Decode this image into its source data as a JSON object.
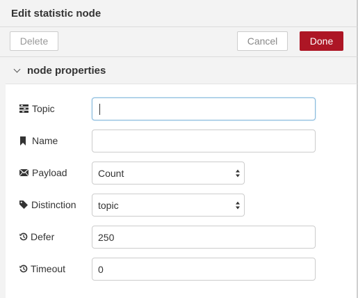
{
  "header": {
    "title": "Edit statistic node"
  },
  "toolbar": {
    "delete_label": "Delete",
    "cancel_label": "Cancel",
    "done_label": "Done"
  },
  "section": {
    "title": "node properties"
  },
  "fields": {
    "topic": {
      "label": "Topic",
      "value": ""
    },
    "name": {
      "label": "Name",
      "value": ""
    },
    "payload": {
      "label": "Payload",
      "selected": "Count"
    },
    "distinction": {
      "label": "Distinction",
      "selected": "topic"
    },
    "defer": {
      "label": "Defer",
      "value": "250"
    },
    "timeout": {
      "label": "Timeout",
      "value": "0"
    }
  },
  "icons": {
    "topic": "tasks-icon",
    "name": "bookmark-icon",
    "payload": "envelope-icon",
    "distinction": "tag-icon",
    "defer": "history-icon",
    "timeout": "history-icon"
  },
  "colors": {
    "done": "#ad1625",
    "focus_border": "#85b7d9"
  }
}
